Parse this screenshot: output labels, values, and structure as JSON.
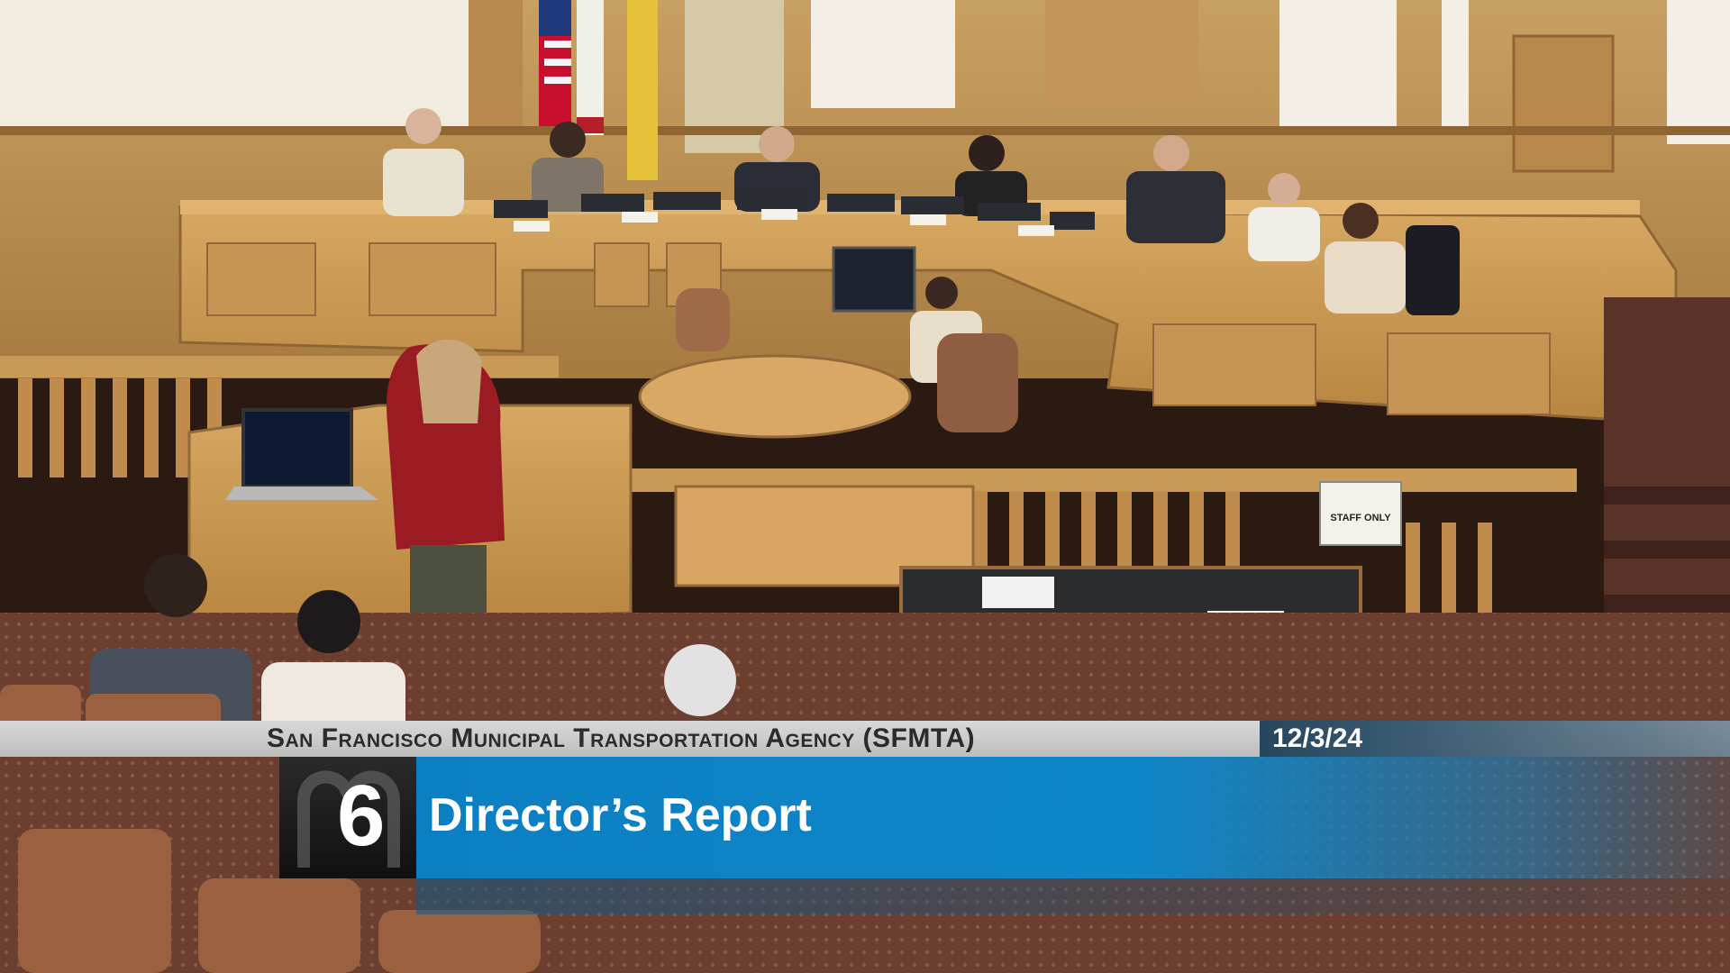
{
  "lower_third": {
    "agency": "San Francisco Municipal Transportation Agency (SFMTA)",
    "date": "12/3/24",
    "item_number": "6",
    "item_title": "Director’s Report",
    "colors": {
      "title_bar": "#0f86c8",
      "agency_bar": "#c9c9c9",
      "number_box": "#1a1a1a"
    }
  },
  "scene": {
    "signs": {
      "staff_only": "STAFF ONLY"
    }
  }
}
